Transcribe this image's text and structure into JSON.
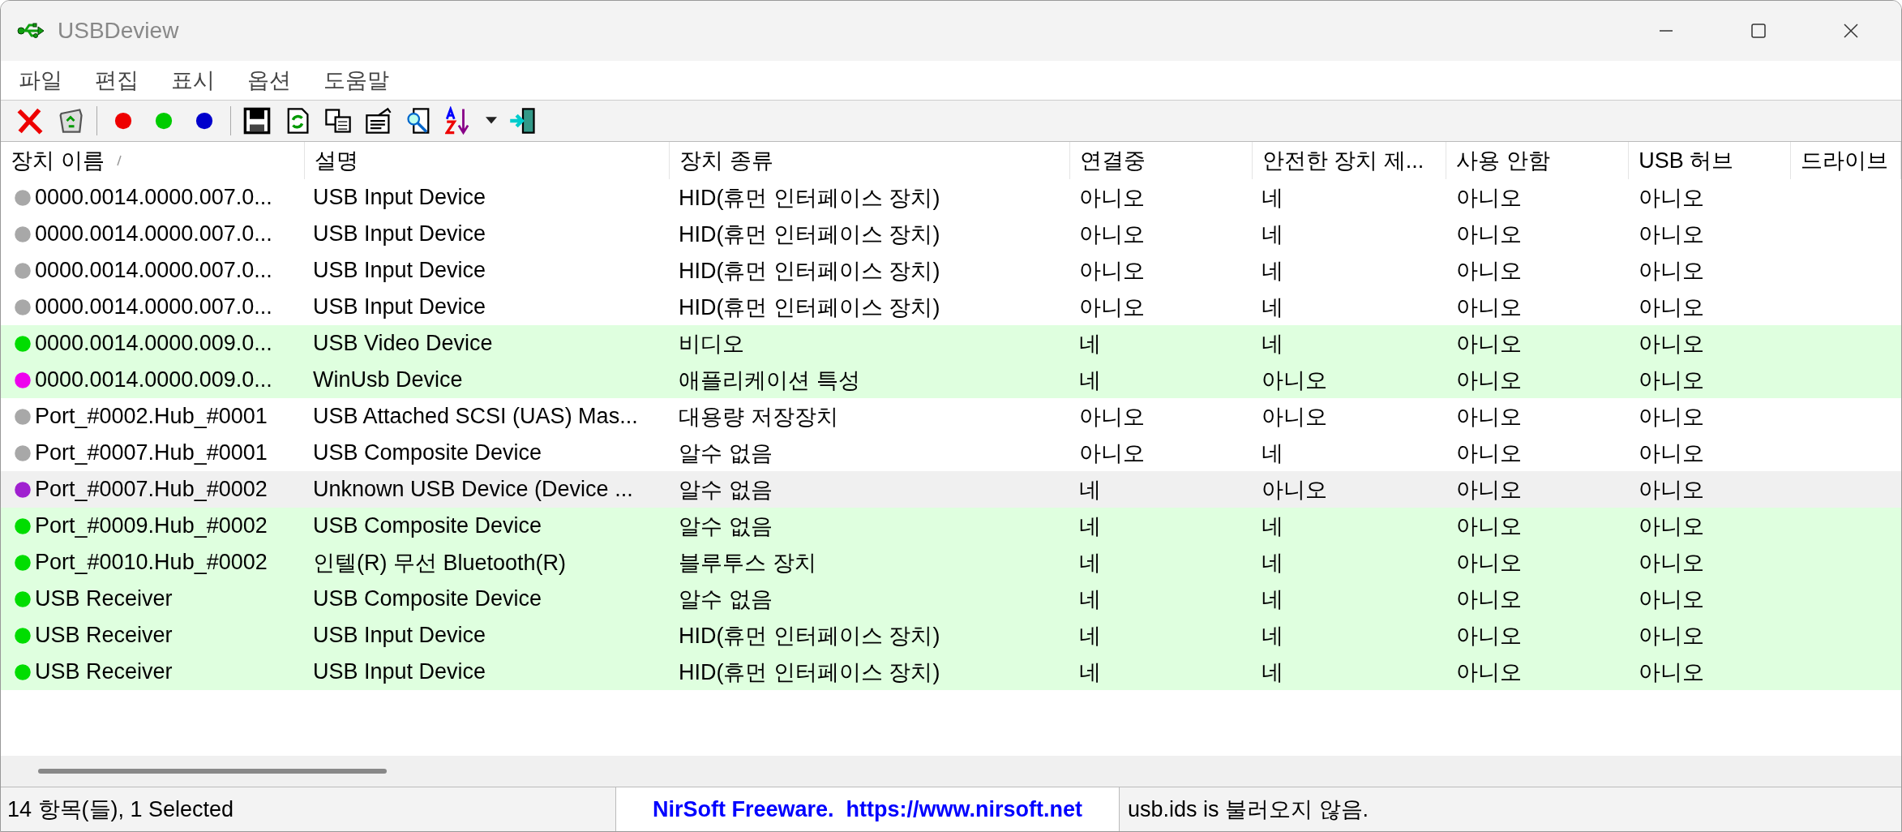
{
  "window": {
    "title": "USBDeview"
  },
  "menu": [
    "파일",
    "편집",
    "표시",
    "옵션",
    "도움말"
  ],
  "columns": [
    "장치 이름",
    "설명",
    "장치 종류",
    "연결중",
    "안전한 장치 제...",
    "사용 안함",
    "USB 허브",
    "드라이브"
  ],
  "rows": [
    {
      "color": "#a8a8a8",
      "highlighted": false,
      "selected": false,
      "cells": [
        "0000.0014.0000.007.0...",
        "USB Input Device",
        "HID(휴먼 인터페이스 장치)",
        "아니오",
        "네",
        "아니오",
        "아니오"
      ]
    },
    {
      "color": "#a8a8a8",
      "highlighted": false,
      "selected": false,
      "cells": [
        "0000.0014.0000.007.0...",
        "USB Input Device",
        "HID(휴먼 인터페이스 장치)",
        "아니오",
        "네",
        "아니오",
        "아니오"
      ]
    },
    {
      "color": "#a8a8a8",
      "highlighted": false,
      "selected": false,
      "cells": [
        "0000.0014.0000.007.0...",
        "USB Input Device",
        "HID(휴먼 인터페이스 장치)",
        "아니오",
        "네",
        "아니오",
        "아니오"
      ]
    },
    {
      "color": "#a8a8a8",
      "highlighted": false,
      "selected": false,
      "cells": [
        "0000.0014.0000.007.0...",
        "USB Input Device",
        "HID(휴먼 인터페이스 장치)",
        "아니오",
        "네",
        "아니오",
        "아니오"
      ]
    },
    {
      "color": "#00dd00",
      "highlighted": true,
      "selected": false,
      "cells": [
        "0000.0014.0000.009.0...",
        "USB Video Device",
        "비디오",
        "네",
        "네",
        "아니오",
        "아니오"
      ]
    },
    {
      "color": "#ee00ee",
      "highlighted": true,
      "selected": false,
      "cells": [
        "0000.0014.0000.009.0...",
        "WinUsb Device",
        "애플리케이션 특성",
        "네",
        "아니오",
        "아니오",
        "아니오"
      ]
    },
    {
      "color": "#a8a8a8",
      "highlighted": false,
      "selected": false,
      "cells": [
        "Port_#0002.Hub_#0001",
        "USB Attached SCSI (UAS) Mas...",
        "대용량 저장장치",
        "아니오",
        "아니오",
        "아니오",
        "아니오"
      ]
    },
    {
      "color": "#a8a8a8",
      "highlighted": false,
      "selected": false,
      "cells": [
        "Port_#0007.Hub_#0001",
        "USB Composite Device",
        "알수 없음",
        "아니오",
        "네",
        "아니오",
        "아니오"
      ]
    },
    {
      "color": "#a020d0",
      "highlighted": true,
      "selected": true,
      "cells": [
        "Port_#0007.Hub_#0002",
        "Unknown USB Device (Device ...",
        "알수 없음",
        "네",
        "아니오",
        "아니오",
        "아니오"
      ]
    },
    {
      "color": "#00dd00",
      "highlighted": true,
      "selected": false,
      "cells": [
        "Port_#0009.Hub_#0002",
        "USB Composite Device",
        "알수 없음",
        "네",
        "네",
        "아니오",
        "아니오"
      ]
    },
    {
      "color": "#00dd00",
      "highlighted": true,
      "selected": false,
      "cells": [
        "Port_#0010.Hub_#0002",
        "인텔(R) 무선 Bluetooth(R)",
        "블루투스 장치",
        "네",
        "네",
        "아니오",
        "아니오"
      ]
    },
    {
      "color": "#00dd00",
      "highlighted": true,
      "selected": false,
      "cells": [
        "USB Receiver",
        "USB Composite Device",
        "알수 없음",
        "네",
        "네",
        "아니오",
        "아니오"
      ]
    },
    {
      "color": "#00dd00",
      "highlighted": true,
      "selected": false,
      "cells": [
        "USB Receiver",
        "USB Input Device",
        "HID(휴먼 인터페이스 장치)",
        "네",
        "네",
        "아니오",
        "아니오"
      ]
    },
    {
      "color": "#00dd00",
      "highlighted": true,
      "selected": false,
      "cells": [
        "USB Receiver",
        "USB Input Device",
        "HID(휴먼 인터페이스 장치)",
        "네",
        "네",
        "아니오",
        "아니오"
      ]
    }
  ],
  "status_bar": {
    "count": "14 항목(들), 1 Selected",
    "link": "NirSoft Freeware.  https://www.nirsoft.net",
    "message": "usb.ids is 불러오지 않음."
  }
}
